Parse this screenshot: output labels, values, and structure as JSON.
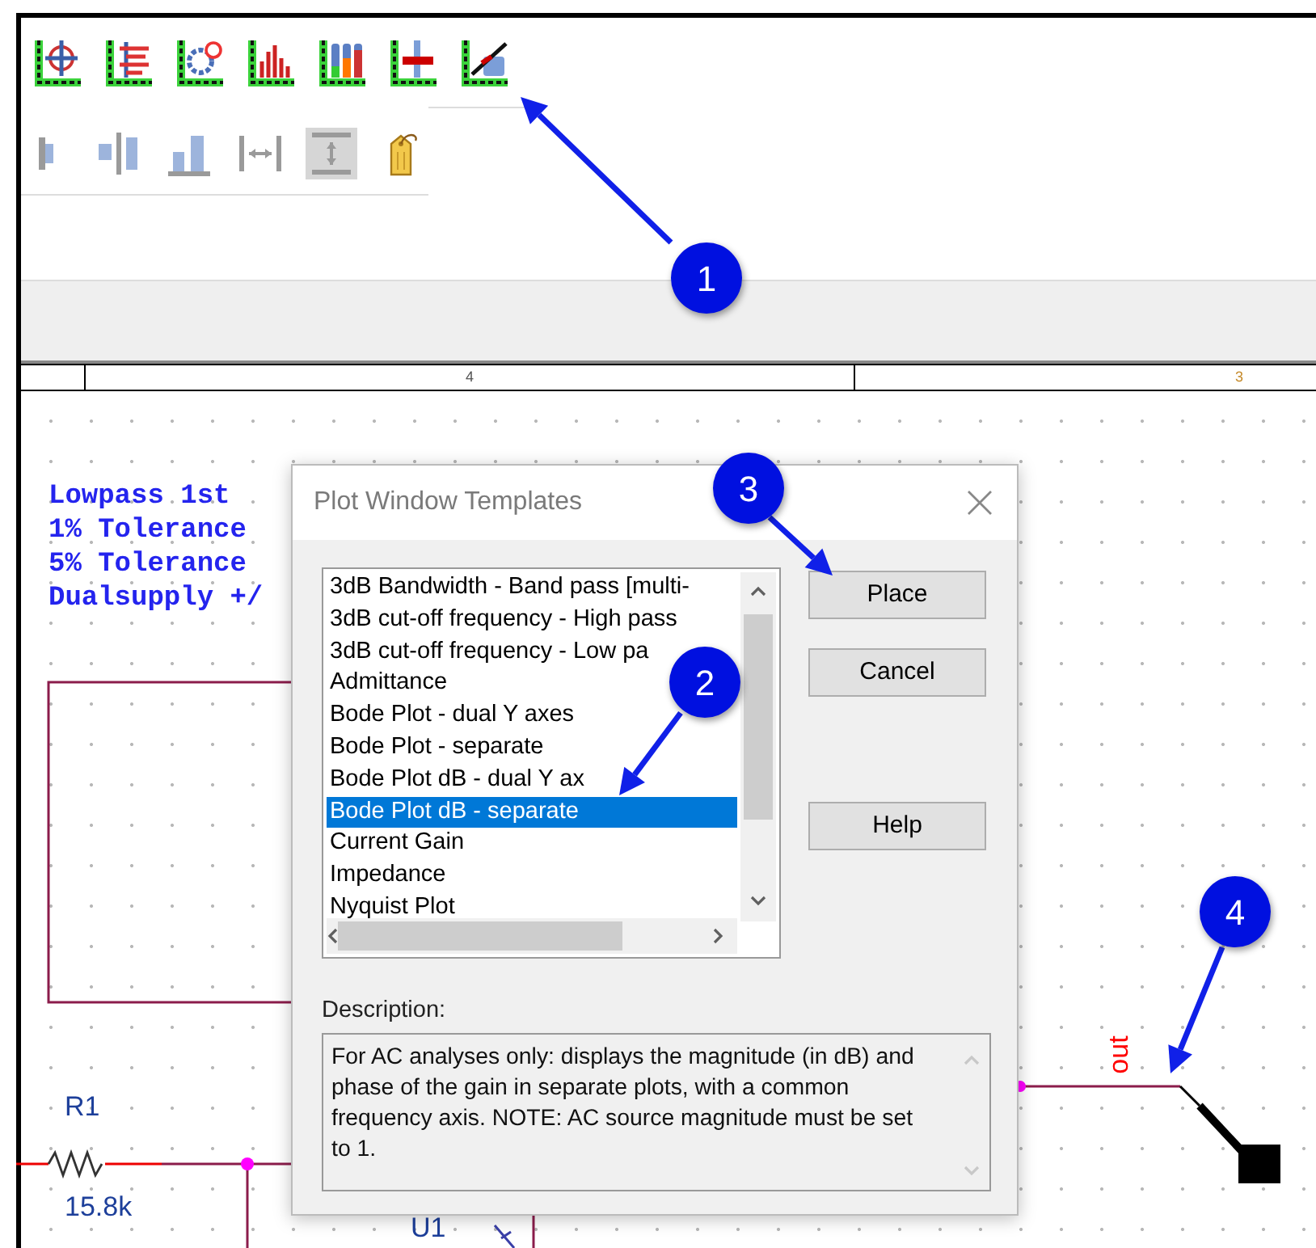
{
  "ruler": {
    "labels": [
      "4",
      "3"
    ]
  },
  "schematic": {
    "notes": [
      "Lowpass 1st",
      "1% Tolerance",
      "5% Tolerance",
      "Dualsupply +/"
    ],
    "resistor": {
      "name": "R1",
      "value": "15.8k"
    },
    "opamp": {
      "name": "U1"
    },
    "probe": {
      "label": "out"
    }
  },
  "dialog": {
    "title": "Plot Window Templates",
    "templates": [
      {
        "label": "3dB Bandwidth - Band pass [multi-",
        "selected": false
      },
      {
        "label": "3dB cut-off frequency - High pass",
        "selected": false
      },
      {
        "label": "3dB cut-off frequency - Low pa",
        "selected": false
      },
      {
        "label": "Admittance",
        "selected": false
      },
      {
        "label": "Bode Plot - dual Y axes",
        "selected": false
      },
      {
        "label": "Bode Plot - separate",
        "selected": false
      },
      {
        "label": "Bode Plot dB - dual Y ax",
        "selected": false
      },
      {
        "label": "Bode Plot dB - separate",
        "selected": true
      },
      {
        "label": "Current Gain",
        "selected": false
      },
      {
        "label": "Impedance",
        "selected": false
      },
      {
        "label": "Nyquist Plot",
        "selected": false
      }
    ],
    "buttons": [
      "Place",
      "Cancel",
      "Help"
    ],
    "description_label": "Description:",
    "description": "For AC analyses only: displays the magnitude (in dB) and phase of the gain in separate plots, with a common frequency axis.  NOTE: AC source magnitude must be set to 1."
  },
  "callouts": [
    "1",
    "2",
    "3",
    "4"
  ]
}
